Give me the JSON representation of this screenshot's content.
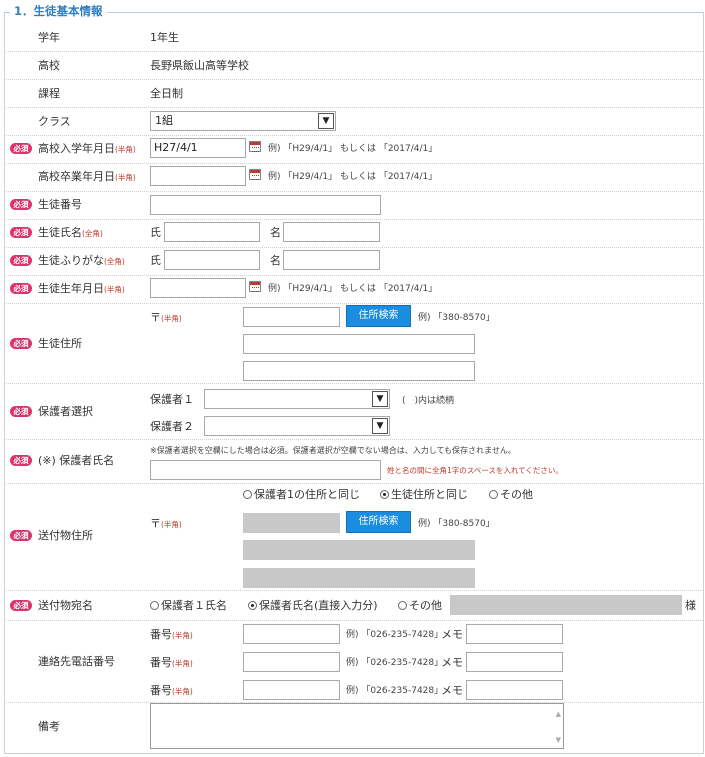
{
  "section": {
    "title": "1．生徒基本情報"
  },
  "required_badge": "必須",
  "half_width_note": "(半角)",
  "full_width_note": "(全角)",
  "date_example": "例) 「H29/4/1」 もしくは 「2017/4/1」",
  "grade": {
    "label": "学年",
    "value": "1年生"
  },
  "school": {
    "label": "高校",
    "value": "長野県飯山高等学校"
  },
  "course": {
    "label": "課程",
    "value": "全日制"
  },
  "class_field": {
    "label": "クラス",
    "selected": "1組"
  },
  "admission_date": {
    "label": "高校入学年月日",
    "value": "H27/4/1"
  },
  "graduation_date": {
    "label": "高校卒業年月日",
    "value": ""
  },
  "student_number": {
    "label": "生徒番号",
    "value": ""
  },
  "student_name": {
    "label": "生徒氏名",
    "family_label": "氏",
    "given_label": "名"
  },
  "student_kana": {
    "label": "生徒ふりがな",
    "family_label": "氏",
    "given_label": "名"
  },
  "birth_date": {
    "label": "生徒生年月日",
    "value": ""
  },
  "student_address": {
    "label": "生徒住所",
    "postal_mark": "〒",
    "search_button": "住所検索",
    "postal_example": "例) 「380-8570」"
  },
  "guardian_select": {
    "label": "保護者選択",
    "guardian1_label": "保護者１",
    "guardian2_label": "保護者２",
    "note": "(　)内は続柄"
  },
  "guardian_name": {
    "label": "(※) 保護者氏名",
    "notice": "※保護者選択を空欄にした場合は必須。保護者選択が空欄でない場合は、入力しても保存されません。",
    "space_note": "姓と名の間に全角1字のスペースを入れてください。"
  },
  "mailing_address": {
    "label": "送付物住所",
    "options": [
      "保護者1の住所と同じ",
      "生徒住所と同じ",
      "その他"
    ],
    "selected_index": 1,
    "postal_mark": "〒",
    "search_button": "住所検索",
    "postal_example": "例) 「380-8570」"
  },
  "mailing_name": {
    "label": "送付物宛名",
    "options": [
      "保護者１氏名",
      "保護者氏名(直接入力分)",
      "その他"
    ],
    "selected_index": 1,
    "suffix": "様"
  },
  "contact_phone": {
    "label": "連絡先電話番号",
    "number_label": "番号",
    "example": "例) 「026-235-7428」",
    "memo_label": "メモ"
  },
  "remarks": {
    "label": "備考"
  },
  "colors": {
    "accent": "#2f7fc1",
    "required": "#d9336b",
    "button": "#1a8de0",
    "disabled_field": "#c8c8c8"
  }
}
